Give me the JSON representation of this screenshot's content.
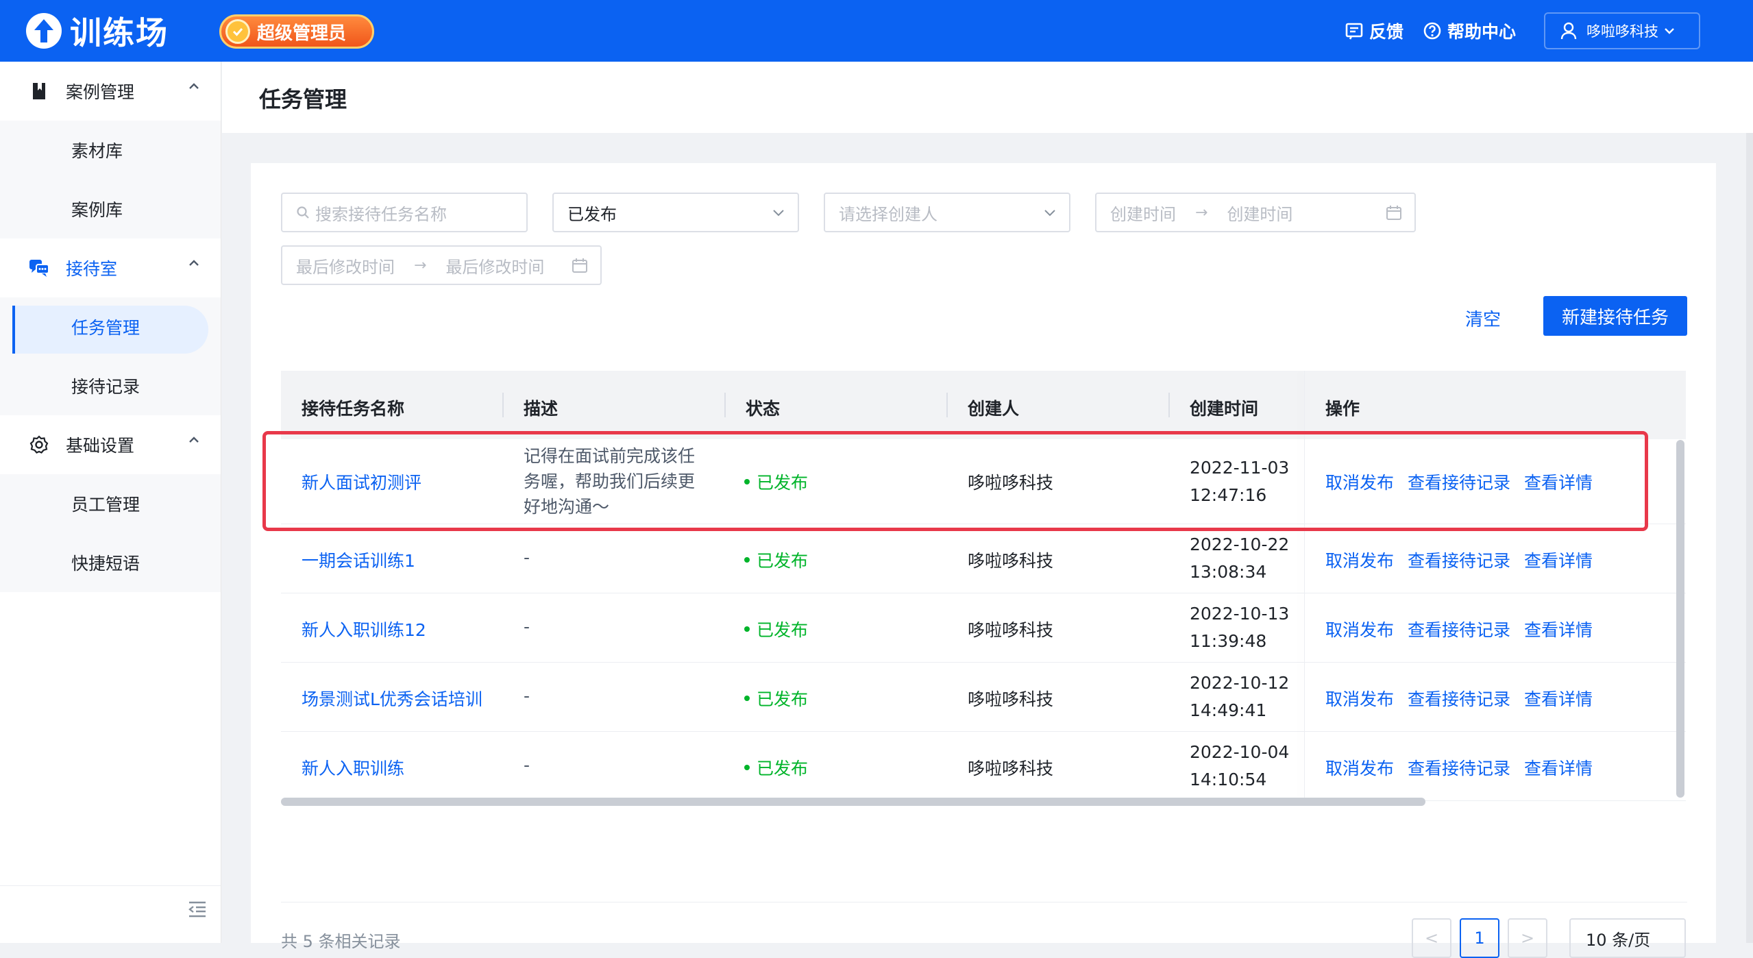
{
  "header": {
    "logo_text": "训练场",
    "role_badge": "超级管理员",
    "feedback": "反馈",
    "help": "帮助中心",
    "user": "哆啦哆科技"
  },
  "sidebar": {
    "groups": [
      {
        "label": "案例管理",
        "icon": "book-icon",
        "items": [
          "素材库",
          "案例库"
        ]
      },
      {
        "label": "接待室",
        "icon": "chat-icon",
        "items": [
          "任务管理",
          "接待记录"
        ]
      },
      {
        "label": "基础设置",
        "icon": "gear-icon",
        "items": [
          "员工管理",
          "快捷短语"
        ]
      }
    ],
    "active_item": "任务管理"
  },
  "page": {
    "title": "任务管理"
  },
  "filters": {
    "search_placeholder": "搜索接待任务名称",
    "status_value": "已发布",
    "creator_placeholder": "请选择创建人",
    "created_start": "创建时间",
    "created_end": "创建时间",
    "modified_start": "最后修改时间",
    "modified_end": "最后修改时间",
    "arrow": "→",
    "clear": "清空",
    "new_task": "新建接待任务"
  },
  "table": {
    "columns": [
      "接待任务名称",
      "描述",
      "状态",
      "创建人",
      "创建时间",
      "操作"
    ],
    "rows": [
      {
        "name": "新人面试初测评",
        "desc_lines": [
          "记得在面试前完成该任",
          "务喔，帮助我们后续更",
          "好地沟通～"
        ],
        "status": "已发布",
        "creator": "哆啦哆科技",
        "date": "2022-11-03",
        "time": "12:47:16"
      },
      {
        "name": "一期会话训练1",
        "desc_lines": [
          "-"
        ],
        "status": "已发布",
        "creator": "哆啦哆科技",
        "date": "2022-10-22",
        "time": "13:08:34"
      },
      {
        "name": "新人入职训练12",
        "desc_lines": [
          "-"
        ],
        "status": "已发布",
        "creator": "哆啦哆科技",
        "date": "2022-10-13",
        "time": "11:39:48"
      },
      {
        "name": "场景测试L优秀会话培训",
        "desc_lines": [
          "-"
        ],
        "status": "已发布",
        "creator": "哆啦哆科技",
        "date": "2022-10-12",
        "time": "14:49:41"
      },
      {
        "name": "新人入职训练",
        "desc_lines": [
          "-"
        ],
        "status": "已发布",
        "creator": "哆啦哆科技",
        "date": "2022-10-04",
        "time": "14:10:54"
      }
    ],
    "actions": [
      "取消发布",
      "查看接待记录",
      "查看详情"
    ]
  },
  "pagination": {
    "total_text": "共 5 条相关记录",
    "prev": "<",
    "current": "1",
    "next": ">",
    "page_size": "10 条/页"
  },
  "colors": {
    "brand": "#0b62f2",
    "success": "#00b42a",
    "highlight": "#e8384a"
  }
}
